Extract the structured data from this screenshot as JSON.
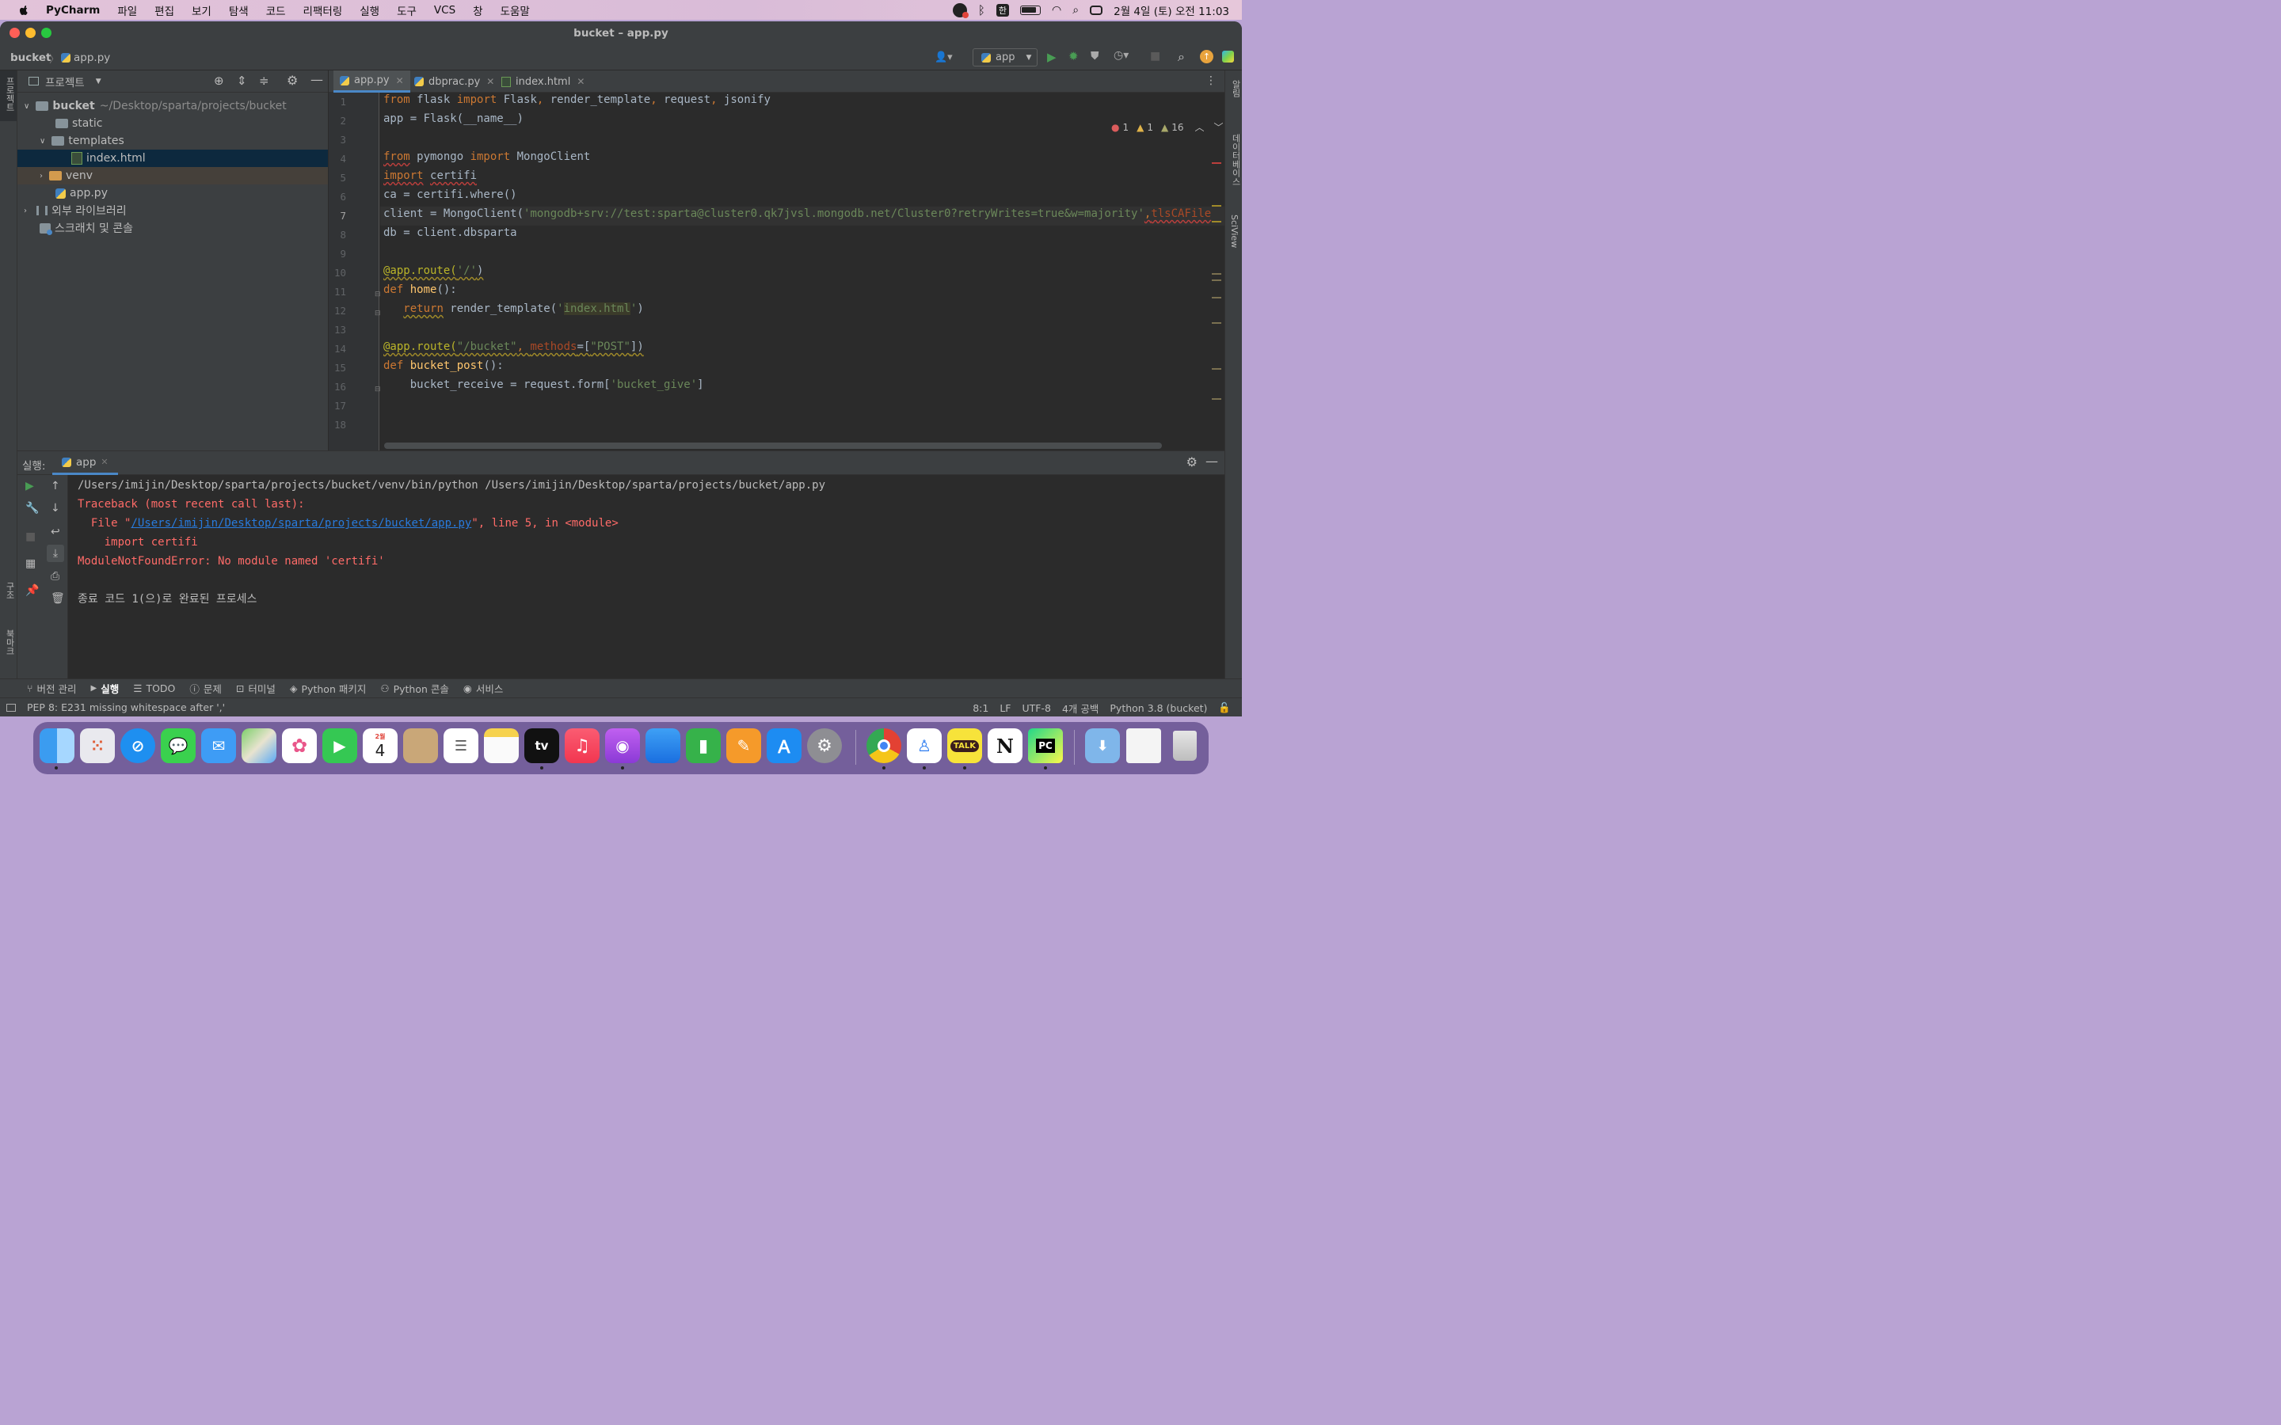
{
  "menubar": {
    "app": "PyCharm",
    "items": [
      "파일",
      "편집",
      "보기",
      "탐색",
      "코드",
      "리팩터링",
      "실행",
      "도구",
      "VCS",
      "창",
      "도움말"
    ],
    "input_method": "한",
    "clock": "2월 4일 (토) 오전 11:03"
  },
  "window": {
    "title": "bucket – app.py",
    "breadcrumb_project": "bucket",
    "breadcrumb_file": "app.py",
    "run_config": "app"
  },
  "left_strip": {
    "project": "프로젝트",
    "structure": "구조",
    "bookmarks": "북마크"
  },
  "right_strip": {
    "notifications": "알림",
    "database": "데이터베이스",
    "sciview": "SciView"
  },
  "project_panel": {
    "title": "프로젝트",
    "root_name": "bucket",
    "root_path": "~/Desktop/sparta/projects/bucket",
    "items": [
      "static",
      "templates",
      "index.html",
      "venv",
      "app.py",
      "외부 라이브러리",
      "스크래치 및 콘솔"
    ]
  },
  "editor": {
    "tabs": [
      "app.py",
      "dbprac.py",
      "index.html"
    ],
    "inspections": {
      "errors": "1",
      "warnings": "1",
      "weak_warnings": "16"
    },
    "line_numbers": [
      "1",
      "2",
      "3",
      "4",
      "5",
      "6",
      "7",
      "8",
      "9",
      "10",
      "11",
      "12",
      "13",
      "14",
      "15",
      "16",
      "17",
      "18"
    ]
  },
  "run_panel": {
    "label": "실행:",
    "tab": "app",
    "output": {
      "cmd": "/Users/imijin/Desktop/sparta/projects/bucket/venv/bin/python /Users/imijin/Desktop/sparta/projects/bucket/app.py",
      "traceback": "Traceback (most recent call last):",
      "file_prefix": "  File \"",
      "file_link": "/Users/imijin/Desktop/sparta/projects/bucket/app.py",
      "file_suffix": "\", line 5, in <module>",
      "import_line": "    import certifi",
      "error": "ModuleNotFoundError: No module named 'certifi'",
      "exit": "종료 코드 1(으)로 완료된 프로세스"
    }
  },
  "bottom_tools": [
    "버전 관리",
    "실행",
    "TODO",
    "문제",
    "터미널",
    "Python 패키지",
    "Python 콘솔",
    "서비스"
  ],
  "status": {
    "message": "PEP 8: E231 missing whitespace after ','",
    "position": "8:1",
    "line_sep": "LF",
    "encoding": "UTF-8",
    "indent": "4개 공백",
    "interpreter": "Python 3.8 (bucket)"
  },
  "dock": {
    "calendar_month": "2월",
    "calendar_day": "4",
    "tv_label": "tv",
    "talk_label": "TALK",
    "notion_label": "N",
    "pycharm_label": "PC"
  },
  "colors": {
    "accent_blue": "#4a88c7",
    "error_red": "#ff6b68",
    "keyword": "#cc7832",
    "string": "#6a8759",
    "decorator": "#bbb529",
    "function": "#ffc66d"
  }
}
